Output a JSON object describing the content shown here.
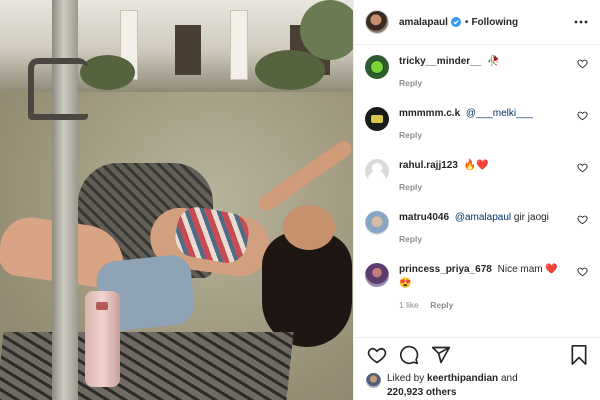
{
  "header": {
    "username": "amalapaul",
    "separator": "•",
    "follow_label": "Following"
  },
  "comments": [
    {
      "username": "tricky__minder__",
      "text": "",
      "emoji": "🥀",
      "reply_label": "Reply"
    },
    {
      "username": "mmmmm.c.k",
      "mention": "@___melki___",
      "text": "",
      "reply_label": "Reply"
    },
    {
      "username": "rahul.rajj123",
      "text": "",
      "emoji": "🔥❤️",
      "reply_label": "Reply"
    },
    {
      "username": "matru4046",
      "mention": "@amalapaul",
      "text": " gir jaogi",
      "reply_label": "Reply"
    },
    {
      "username": "princess_priya_678",
      "text": " Nice mam ",
      "emoji": "❤️",
      "emoji2": "😍",
      "likes_label": "1 like",
      "reply_label": "Reply"
    }
  ],
  "likes": {
    "prefix": "Liked by ",
    "user": "keerthipandian",
    "middle": " and",
    "count": "220,923 others"
  },
  "icons": {
    "verified": "verified-badge-icon",
    "more": "more-options-icon",
    "heart": "heart-icon",
    "comment": "comment-icon",
    "share": "share-icon",
    "save": "bookmark-icon"
  },
  "colors": {
    "verified_blue": "#3897f0",
    "text": "#262626",
    "muted": "#8e8e8e",
    "mention": "#00376b"
  }
}
